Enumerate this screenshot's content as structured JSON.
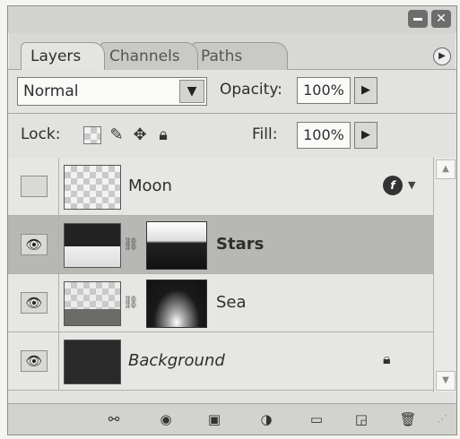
{
  "tabs": [
    {
      "label": "Layers"
    },
    {
      "label": "Channels"
    },
    {
      "label": "Paths"
    }
  ],
  "blend": {
    "mode": "Normal",
    "opacity_label": "Opacity:",
    "opacity_value": "100%"
  },
  "lock": {
    "label": "Lock:",
    "fill_label": "Fill:",
    "fill_value": "100%"
  },
  "layers": [
    {
      "name": "Moon",
      "visible": false,
      "has_fx": true
    },
    {
      "name": "Stars",
      "visible": true,
      "selected": true,
      "has_mask": true
    },
    {
      "name": "Sea",
      "visible": true,
      "has_mask": true
    },
    {
      "name": "Background",
      "visible": true,
      "locked": true
    }
  ],
  "icons": {
    "eye": "eye-icon",
    "link": "link-layers-icon",
    "fx": "layer-style-icon",
    "mask": "add-mask-icon",
    "adjust": "adjustment-layer-icon",
    "group": "new-group-icon",
    "new": "new-layer-icon",
    "trash": "delete-layer-icon"
  }
}
